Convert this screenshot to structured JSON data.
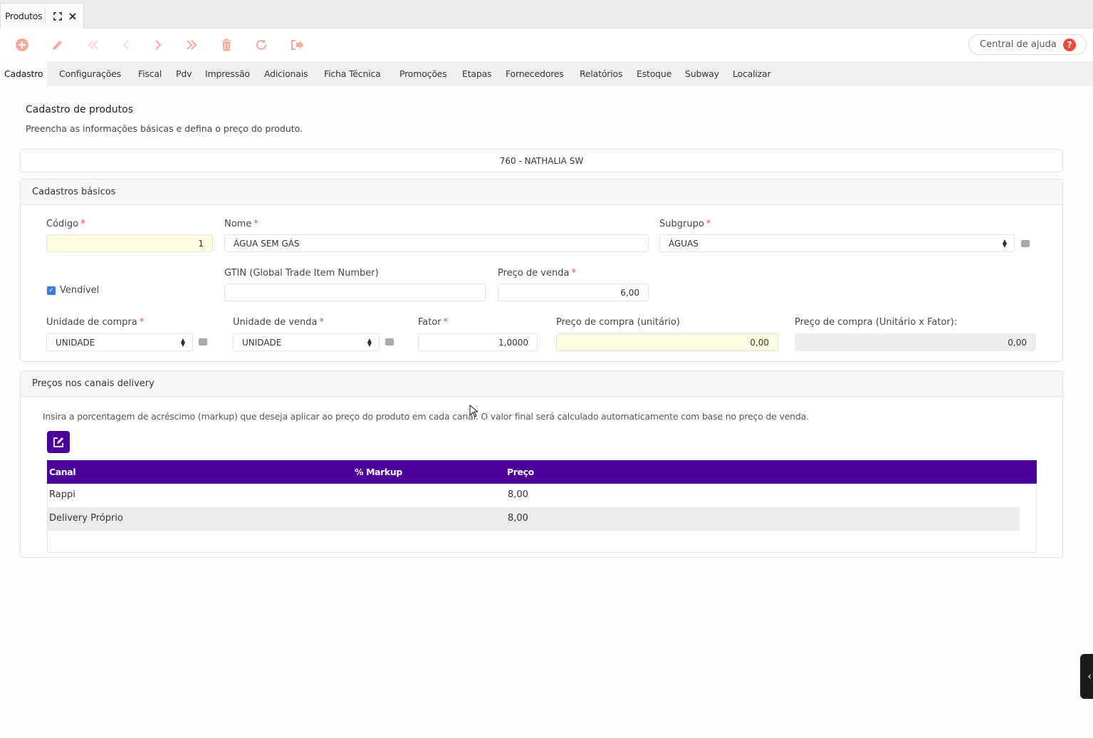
{
  "window_tab": {
    "title": "Produtos",
    "expand_icon": "expand-icon",
    "close_icon": "close-icon"
  },
  "toolbar": {
    "icons": [
      "add-icon",
      "edit-pencil-icon",
      "first-icon",
      "previous-icon",
      "next-icon",
      "last-icon",
      "delete-icon",
      "refresh-icon",
      "exit-icon"
    ],
    "help_label": "Central de ajuda",
    "help_icon_text": "?"
  },
  "menu_tabs": [
    "Cadastro",
    "Configurações",
    "Fiscal",
    "Pdv",
    "Impressão",
    "Adicionais",
    "Ficha Técnica",
    "Promoções",
    "Etapas",
    "Fornecedores",
    "Relatórios",
    "Estoque",
    "Subway",
    "Localizar"
  ],
  "page": {
    "title": "Cadastro de produtos",
    "subtitle": "Preencha as informações básicas e defina o preço do produto.",
    "company": "760 - NATHALIA SW"
  },
  "basic": {
    "header": "Cadastros básicos",
    "codigo_label": "Código",
    "codigo_value": "1",
    "nome_label": "Nome",
    "nome_value": "ÁGUA SEM GÁS",
    "subgrupo_label": "Subgrupo",
    "subgrupo_value": "ÁGUAS",
    "vendivel_label": "Vendível",
    "gtin_label": "GTIN (Global Trade Item Number)",
    "gtin_value": "",
    "preco_venda_label": "Preço de venda",
    "preco_venda_value": "6,00",
    "unidade_compra_label": "Unidade de compra",
    "unidade_compra_value": "UNIDADE",
    "unidade_venda_label": "Unidade de venda",
    "unidade_venda_value": "UNIDADE",
    "fator_label": "Fator",
    "fator_value": "1,0000",
    "preco_compra_label": "Preço de compra (unitário)",
    "preco_compra_value": "0,00",
    "preco_compra_fator_label": "Preço de compra (Unitário x Fator):",
    "preco_compra_fator_value": "0,00",
    "required_mark": "*"
  },
  "delivery": {
    "header": "Preços nos canais delivery",
    "info": "Insira a porcentagem de acréscimo (markup) que deseja aplicar ao preço do produto em cada canal. O valor final será calculado automaticamente com base no preço de venda.",
    "columns": [
      "Canal",
      "% Markup",
      "Preço"
    ],
    "rows": [
      {
        "canal": "Rappi",
        "markup": "",
        "preco": "8,00"
      },
      {
        "canal": "Delivery Próprio",
        "markup": "",
        "preco": "8,00"
      }
    ]
  },
  "colors": {
    "accent_purple": "#4c0099",
    "toolbar_icon": "#f4a99b",
    "help_red": "#ea4b3c"
  }
}
